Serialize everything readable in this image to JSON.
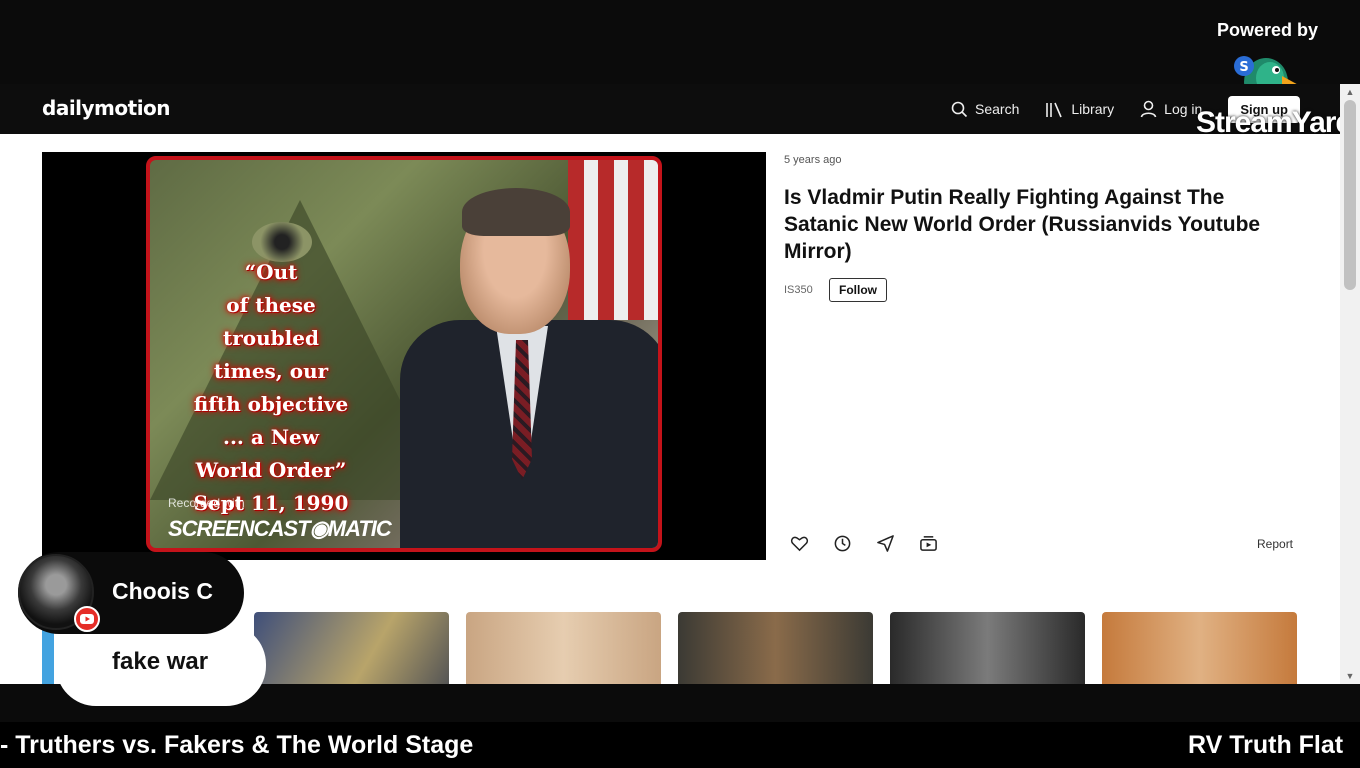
{
  "overlay": {
    "powered_by": "Powered by",
    "brand_word": "StreamYard"
  },
  "header": {
    "logo": "dailymotion",
    "search_label": "Search",
    "library_label": "Library",
    "login_label": "Log in",
    "signup_label": "Sign up"
  },
  "video": {
    "posted": "5 years ago",
    "title": "Is Vladmir Putin Really Fighting Against The Satanic New World Order (Russianvids Youtube Mirror)",
    "channel": "IS350",
    "follow_label": "Follow",
    "report_label": "Report",
    "thumbnail": {
      "quote_lines": [
        "“Out",
        "of these",
        "troubled",
        "times, our",
        "fifth objective",
        "... a New",
        "World Order”",
        "Sept 11, 1990"
      ],
      "recorded_with": "Recorded with",
      "recorder_brand": "SCREENCAST◉MATIC"
    }
  },
  "actions": [
    "heart-icon",
    "clock-icon",
    "share-icon",
    "add-to-playlist-icon"
  ],
  "recommendations": [
    {
      "color_a": "#3f4f7a",
      "color_b": "#b8a46a"
    },
    {
      "color_a": "#c9a582",
      "color_b": "#e6cdb0"
    },
    {
      "color_a": "#3b3a34",
      "color_b": "#8a6b4a"
    },
    {
      "color_a": "#2a2a2a",
      "color_b": "#7b7b7b"
    },
    {
      "color_a": "#c57a3c",
      "color_b": "#e0b183"
    }
  ],
  "comment": {
    "author": "Choois C",
    "text": "fake war"
  },
  "ticker": {
    "left_text": "- Truthers vs. Fakers & The World Stage",
    "right_text": "RV Truth Flat"
  },
  "colors": {
    "accent_red": "#c4131a",
    "youtube_red": "#e52d27",
    "edge_blue": "#43a3e0"
  }
}
